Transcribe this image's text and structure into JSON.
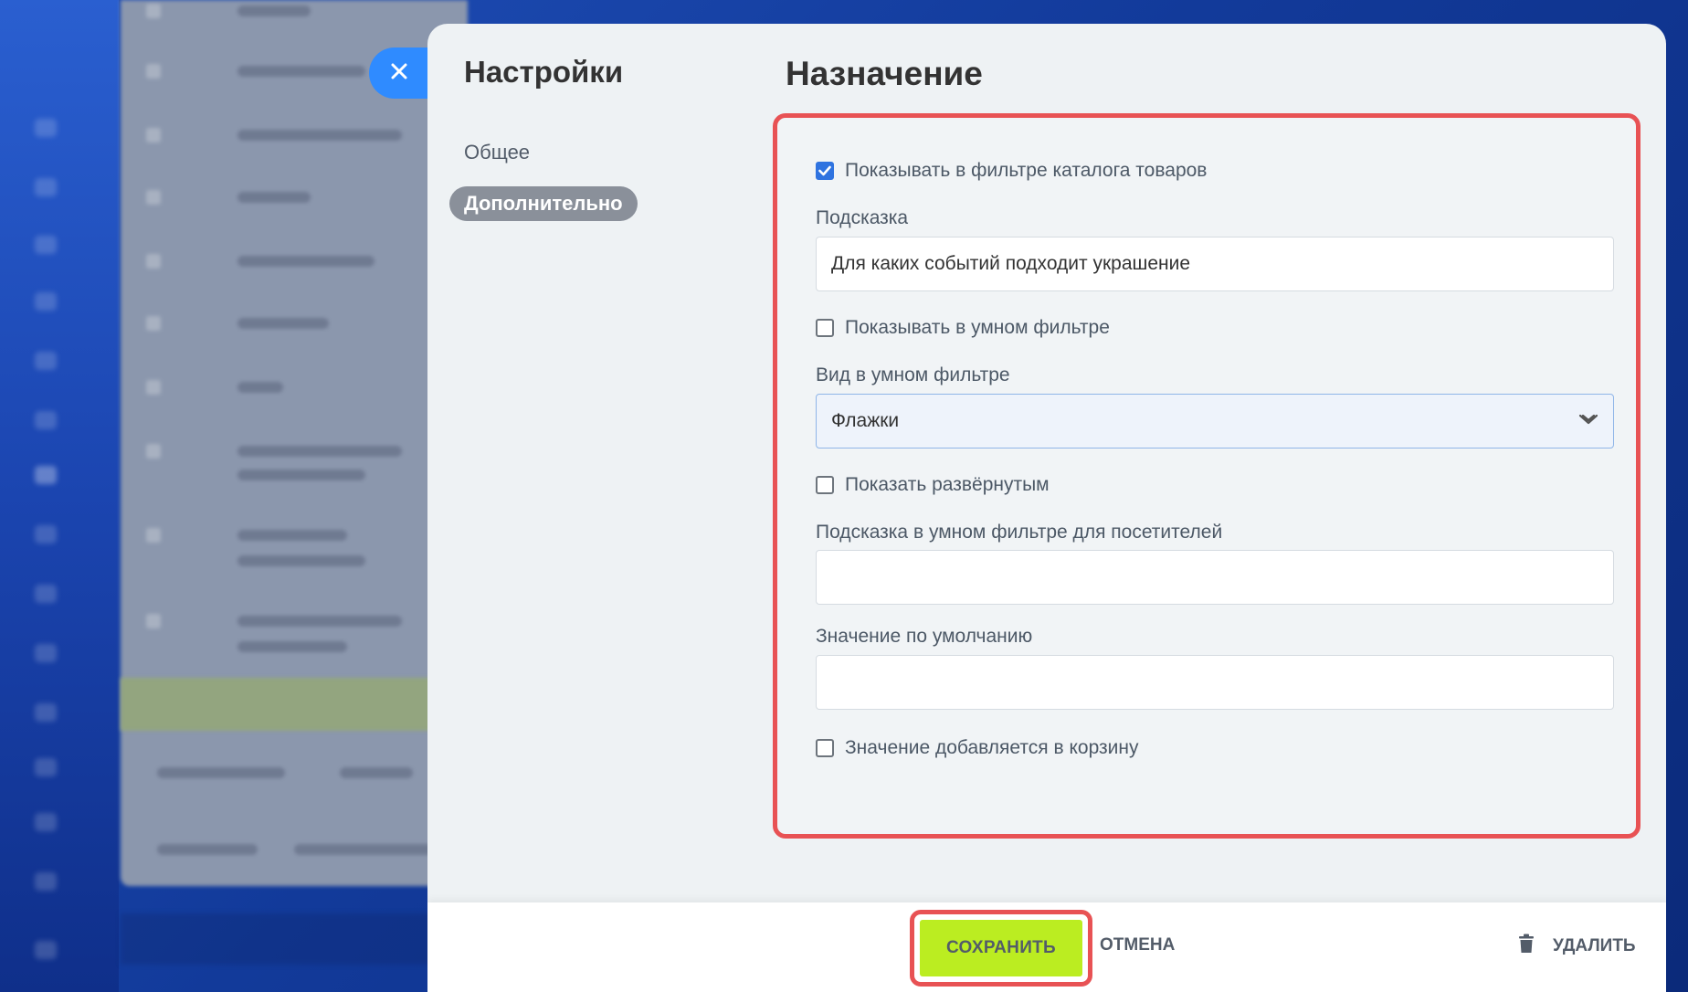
{
  "panel": {
    "title": "Настройки",
    "nav": [
      {
        "label": "Общее",
        "active": false
      },
      {
        "label": "Дополнительно",
        "active": true
      }
    ],
    "section_title": "Назначение"
  },
  "form": {
    "show_in_catalog_filter": {
      "label": "Показывать в фильтре каталога товаров",
      "checked": true
    },
    "hint": {
      "label": "Подсказка",
      "value": "Для каких событий подходит украшение"
    },
    "show_in_smart_filter": {
      "label": "Показывать в умном фильтре",
      "checked": false
    },
    "smart_filter_view": {
      "label": "Вид в умном фильтре",
      "value": "Флажки"
    },
    "show_expanded": {
      "label": "Показать развёрнутым",
      "checked": false
    },
    "smart_filter_hint": {
      "label": "Подсказка в умном фильтре для посетителей",
      "value": ""
    },
    "default_value": {
      "label": "Значение по умолчанию",
      "value": ""
    },
    "added_to_cart": {
      "label": "Значение добавляется в корзину",
      "checked": false
    }
  },
  "footer": {
    "save_label": "СОХРАНИТЬ",
    "cancel_label": "ОТМЕНА",
    "delete_label": "УДАЛИТЬ"
  },
  "icons": {
    "close": "close-icon",
    "chevron": "chevron-down-icon",
    "trash": "trash-icon",
    "check": "checkmark-icon"
  },
  "colors": {
    "accent_blue": "#2f8bff",
    "save_green": "#bbed21",
    "highlight_red": "#e85254",
    "active_nav": "#8a909a"
  }
}
